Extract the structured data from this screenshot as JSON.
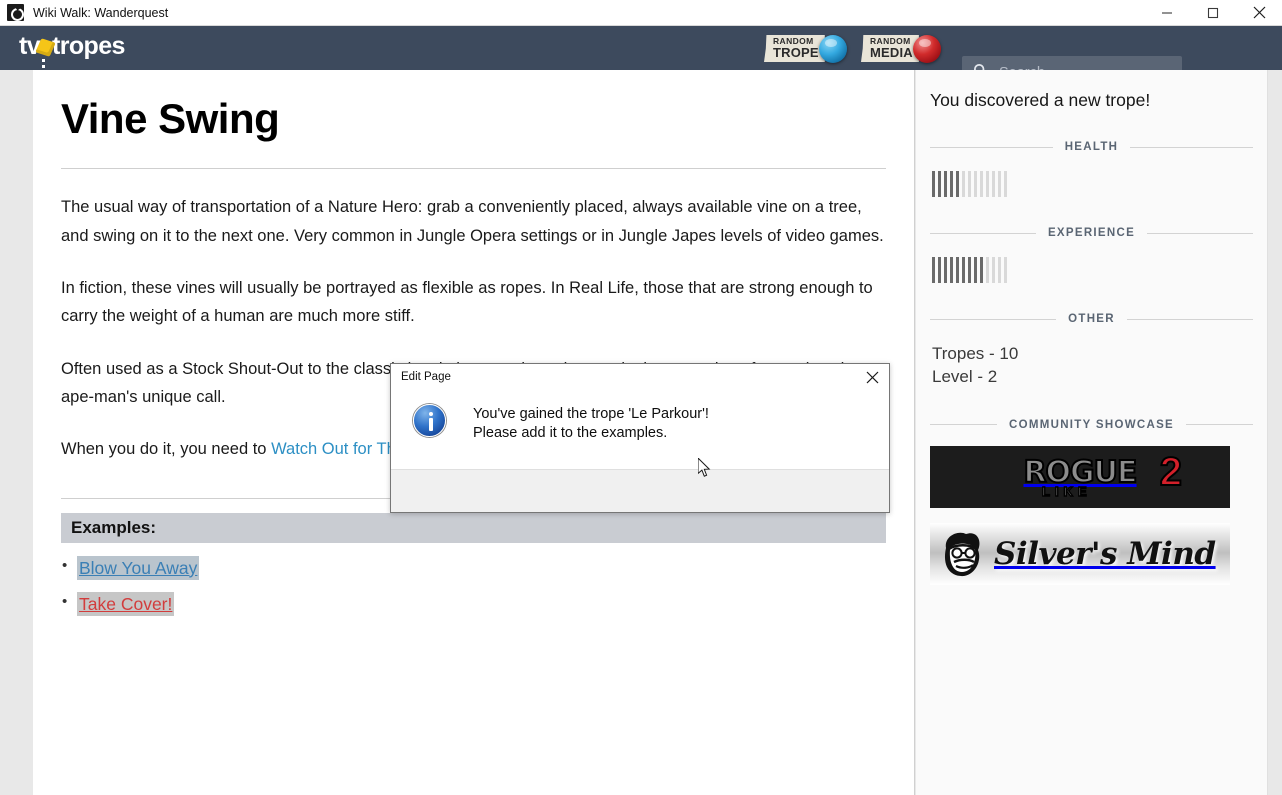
{
  "window": {
    "title": "Wiki Walk: Wanderquest",
    "app_icon": "camera-icon",
    "controls": {
      "minimize": "minimize-icon",
      "maximize": "maximize-icon",
      "close": "close-icon"
    }
  },
  "site_header": {
    "logo_pre": "tv",
    "logo_post": "tropes",
    "random_trope": {
      "line1": "RANDOM",
      "line2": "TROPE",
      "orb_color": "#34a9e0"
    },
    "random_media": {
      "line1": "RANDOM",
      "line2": "MEDIA",
      "orb_color": "#d12b2b"
    },
    "search": {
      "placeholder": "Search",
      "value": "",
      "icon": "search-icon"
    },
    "background": "#3d4a5d"
  },
  "article": {
    "title": "Vine Swing",
    "paragraphs": [
      "The usual way of transportation of a Nature Hero: grab a conveniently placed, always available vine on a tree, and swing on it to the next one. Very common in Jungle Opera settings or in Jungle Japes levels of video games.",
      "In fiction, these vines will usually be portrayed as flexible as ropes. In Real Life, those that are strong enough to carry the weight of a human are much more stiff.",
      "Often used as a Stock Shout-Out to the classic jungle hero stories, where swinging on a vine often makes the ape-man's unique call."
    ],
    "last_paragraph": {
      "prefix": "When you do it, you need to ",
      "link": "Watch Out for That Tree"
    },
    "examples_heading": "Examples:",
    "examples": [
      {
        "label": "Blow You Away",
        "style": "blue"
      },
      {
        "label": "Take Cover!",
        "style": "red"
      }
    ]
  },
  "sidebar": {
    "discovery_message": "You discovered a new trope!",
    "health": {
      "label": "HEALTH",
      "filled": 5,
      "total": 13
    },
    "experience": {
      "label": "EXPERIENCE",
      "filled": 9,
      "total": 13
    },
    "other": {
      "label": "OTHER",
      "stats": [
        "Tropes - 10",
        "Level - 2"
      ]
    },
    "community_showcase": {
      "label": "COMMUNITY SHOWCASE",
      "banners": [
        {
          "name": "rogue-like-2",
          "word": "ROGUE",
          "sub": "LIKE",
          "number": "2"
        },
        {
          "name": "silvers-mind",
          "word": "Silver's Mind"
        }
      ]
    }
  },
  "dialog": {
    "title": "Edit Page",
    "close_icon": "close-icon",
    "info_icon": "info-icon",
    "message_line1": "You've gained the trope 'Le Parkour'!",
    "message_line2": "Please add it to the examples."
  }
}
